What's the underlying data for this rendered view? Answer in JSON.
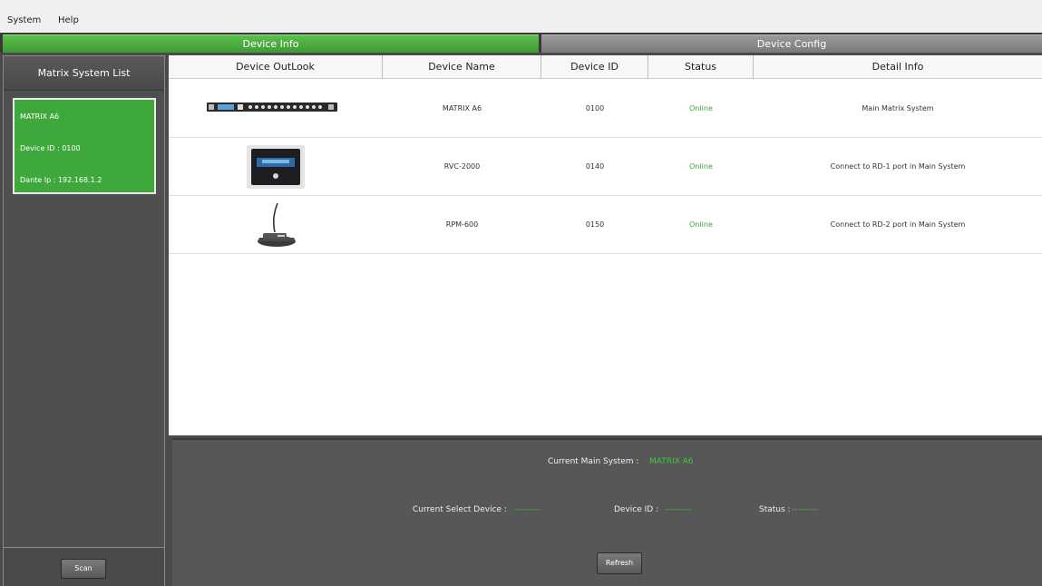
{
  "menu": {
    "system": "System",
    "help": "Help"
  },
  "tabs": {
    "info": "Device Info",
    "config": "Device Config"
  },
  "sidebar": {
    "title": "Matrix System List",
    "card": {
      "name": "MATRIX A6",
      "device_id": "Device ID :  0100",
      "dante_ip": "Dante Ip :  192.168.1.2"
    },
    "scan_label": "Scan"
  },
  "table": {
    "headers": [
      "Device OutLook",
      "Device Name",
      "Device ID",
      "Status",
      "Detail Info"
    ],
    "rows": [
      {
        "name": "MATRIX A6",
        "id": "0100",
        "status": "Online",
        "detail": "Main Matrix System",
        "icon": "rack-device-icon"
      },
      {
        "name": "RVC-2000",
        "id": "0140",
        "status": "Online",
        "detail": "Connect to RD-1 port in Main System",
        "icon": "touch-panel-icon"
      },
      {
        "name": "RPM-600",
        "id": "0150",
        "status": "Online",
        "detail": "Connect to RD-2 port in Main System",
        "icon": "gooseneck-mic-icon"
      }
    ]
  },
  "bottom": {
    "current_main_label": "Current Main System :",
    "current_main_value": "MATRIX A6",
    "select_device_label": "Current Select Device :",
    "select_device_value": "---------",
    "device_id_label": "Device ID :",
    "device_id_value": "---------",
    "status_label": "Status :",
    "status_value": "---------",
    "refresh_label": "Refresh"
  },
  "colors": {
    "accent": "#3ea83c",
    "status_online": "#3ea83c"
  }
}
